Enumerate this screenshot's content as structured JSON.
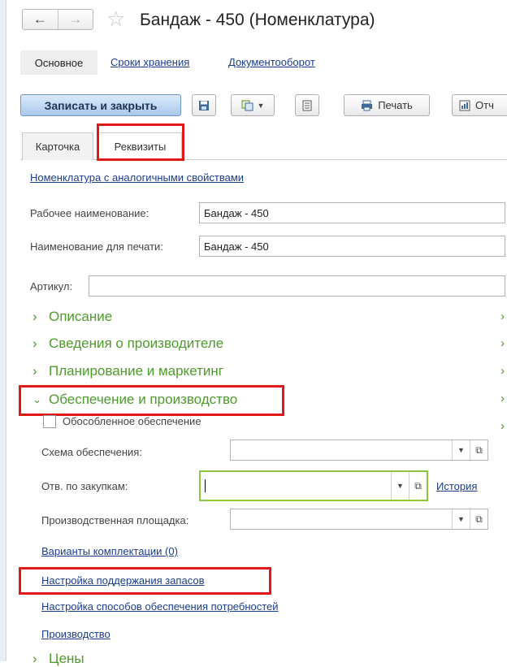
{
  "header": {
    "back_icon": "arrow-left-icon",
    "forward_icon": "arrow-right-icon",
    "favorite_icon": "star-icon",
    "title": "Бандаж - 450 (Номенклатура)"
  },
  "sections": [
    {
      "label": "Основное",
      "active": true
    },
    {
      "label": "Сроки хранения",
      "active": false
    },
    {
      "label": "Документооборот",
      "active": false
    }
  ],
  "toolbar": {
    "save_close_label": "Записать и закрыть",
    "print_label": "Печать",
    "reports_label": "Отч"
  },
  "tabs": [
    {
      "label": "Карточка",
      "active": false
    },
    {
      "label": "Реквизиты",
      "active": true
    }
  ],
  "form": {
    "similar_link": "Номенклатура с аналогичными свойствами",
    "work_name_label": "Рабочее наименование:",
    "work_name_value": "Бандаж - 450",
    "print_name_label": "Наименование для печати:",
    "print_name_value": "Бандаж - 450",
    "article_label": "Артикул:",
    "article_value": ""
  },
  "groups": [
    {
      "label": "Описание",
      "expanded": false
    },
    {
      "label": "Сведения о производителе",
      "expanded": false
    },
    {
      "label": "Планирование и маркетинг",
      "expanded": false
    },
    {
      "label": "Обеспечение и производство",
      "expanded": true
    }
  ],
  "supply": {
    "separate_supply_label": "Обособленное обеспечение",
    "separate_supply_checked": false,
    "scheme_label": "Схема обеспечения:",
    "scheme_value": "",
    "buyer_label": "Отв. по закупкам:",
    "buyer_value": "",
    "history_link": "История",
    "site_label": "Производственная площадка:",
    "site_value": "",
    "kits_link": "Варианты комплектации (0)",
    "stock_link": "Настройка поддержания запасов",
    "methods_link": "Настройка способов обеспечения потребностей",
    "production_link": "Производство"
  },
  "next_group_label": "Цены",
  "colors": {
    "accent_green": "#4d9b2a",
    "link_blue": "#1a3d8f",
    "highlight_red": "#e01818",
    "focus_green": "#8cc63f"
  }
}
